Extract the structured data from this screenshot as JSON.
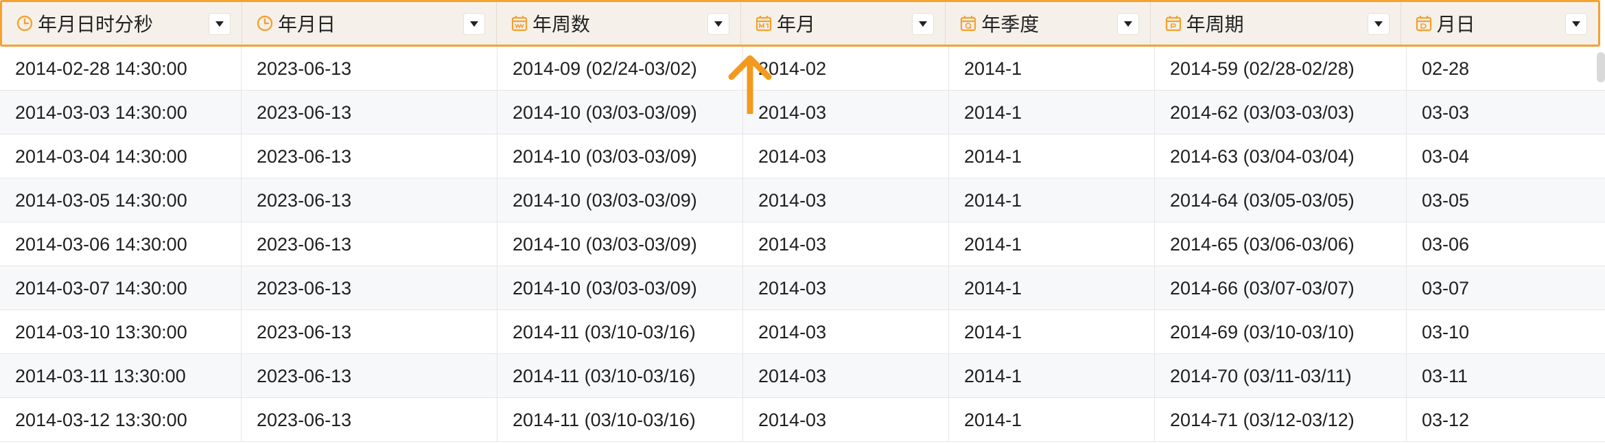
{
  "colors": {
    "accent": "#f4a12f",
    "icon": "#f4a12f",
    "header_bg": "#f5f0ea",
    "row_alt_bg": "#f7f8fa"
  },
  "columns": [
    {
      "label": "年月日时分秒",
      "icon": "clock-icon"
    },
    {
      "label": "年月日",
      "icon": "clock-icon"
    },
    {
      "label": "年周数",
      "icon": "calendar-week-icon"
    },
    {
      "label": "年月",
      "icon": "calendar-month-icon"
    },
    {
      "label": "年季度",
      "icon": "calendar-quarter-icon"
    },
    {
      "label": "年周期",
      "icon": "calendar-period-icon"
    },
    {
      "label": "月日",
      "icon": "calendar-day-icon"
    }
  ],
  "rows": [
    [
      "2014-02-28 14:30:00",
      "2023-06-13",
      "2014-09 (02/24-03/02)",
      "2014-02",
      "2014-1",
      "2014-59 (02/28-02/28)",
      "02-28"
    ],
    [
      "2014-03-03 14:30:00",
      "2023-06-13",
      "2014-10 (03/03-03/09)",
      "2014-03",
      "2014-1",
      "2014-62 (03/03-03/03)",
      "03-03"
    ],
    [
      "2014-03-04 14:30:00",
      "2023-06-13",
      "2014-10 (03/03-03/09)",
      "2014-03",
      "2014-1",
      "2014-63 (03/04-03/04)",
      "03-04"
    ],
    [
      "2014-03-05 14:30:00",
      "2023-06-13",
      "2014-10 (03/03-03/09)",
      "2014-03",
      "2014-1",
      "2014-64 (03/05-03/05)",
      "03-05"
    ],
    [
      "2014-03-06 14:30:00",
      "2023-06-13",
      "2014-10 (03/03-03/09)",
      "2014-03",
      "2014-1",
      "2014-65 (03/06-03/06)",
      "03-06"
    ],
    [
      "2014-03-07 14:30:00",
      "2023-06-13",
      "2014-10 (03/03-03/09)",
      "2014-03",
      "2014-1",
      "2014-66 (03/07-03/07)",
      "03-07"
    ],
    [
      "2014-03-10 13:30:00",
      "2023-06-13",
      "2014-11 (03/10-03/16)",
      "2014-03",
      "2014-1",
      "2014-69 (03/10-03/10)",
      "03-10"
    ],
    [
      "2014-03-11 13:30:00",
      "2023-06-13",
      "2014-11 (03/10-03/16)",
      "2014-03",
      "2014-1",
      "2014-70 (03/11-03/11)",
      "03-11"
    ],
    [
      "2014-03-12 13:30:00",
      "2023-06-13",
      "2014-11 (03/10-03/16)",
      "2014-03",
      "2014-1",
      "2014-71 (03/12-03/12)",
      "03-12"
    ]
  ]
}
